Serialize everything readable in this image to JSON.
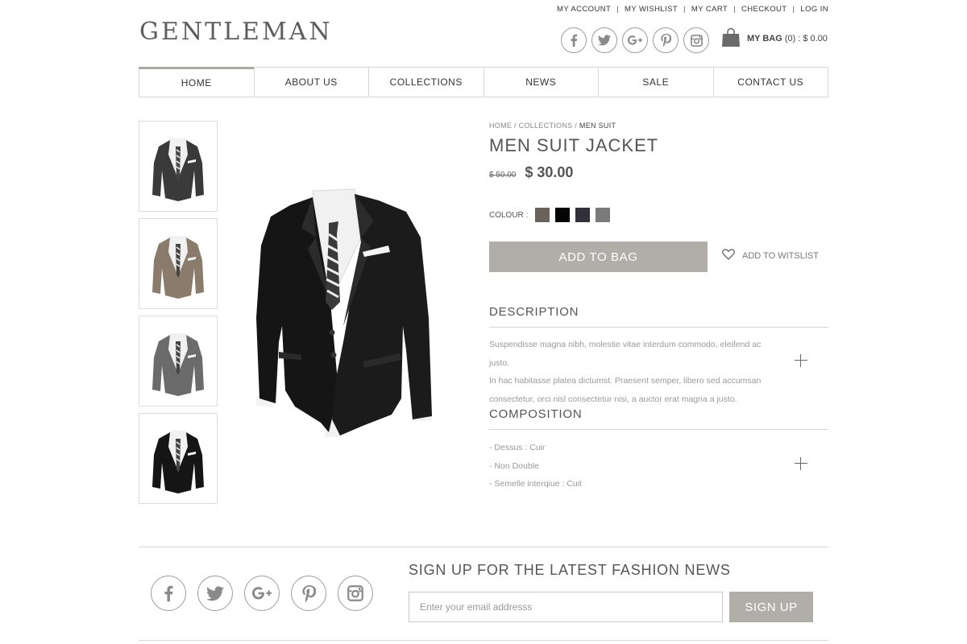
{
  "top_links": [
    "MY ACCOUNT",
    "MY WISHLIST",
    "MY CART",
    "CHECKOUT",
    "LOG IN"
  ],
  "logo": "GENTLEMAN",
  "header_social": [
    "facebook-icon",
    "twitter-icon",
    "google-plus-icon",
    "pinterest-icon",
    "instagram-icon"
  ],
  "bag": {
    "label": "MY BAG",
    "count": "(0)",
    "separator": ":",
    "total": "$ 0.00"
  },
  "nav": [
    {
      "label": "HOME",
      "active": true
    },
    {
      "label": "ABOUT US",
      "active": false
    },
    {
      "label": "COLLECTIONS",
      "active": false
    },
    {
      "label": "NEWS",
      "active": false
    },
    {
      "label": "SALE",
      "active": false
    },
    {
      "label": "CONTACT US",
      "active": false
    }
  ],
  "thumbnails": [
    {
      "color": "#3a3a3a"
    },
    {
      "color": "#8b7b6b"
    },
    {
      "color": "#6b6b6b"
    },
    {
      "color": "#151515"
    }
  ],
  "product": {
    "breadcrumb": {
      "home": "HOME",
      "collections": "COLLECTIONS",
      "current": "MEN SUIT",
      "sep": "/"
    },
    "title": "MEN SUIT JACKET",
    "old_price": "$ 50.00",
    "new_price": "$ 30.00",
    "colour_label": "COLOUR :",
    "colours": [
      "#6b625b",
      "#050505",
      "#30313a",
      "#7b7b7b"
    ],
    "add_to_bag": "ADD TO BAG",
    "wishlist": "ADD TO WITSLIST"
  },
  "description": {
    "title": "DESCRIPTION",
    "lines": [
      "Suspendisse magna nibh, molestie vitae interdum commodo, eleifend ac justo.",
      "In hac habitasse platea dictumst. Praesent semper, libero sed accumsan",
      "consectetur, orci nisl consectetur nisi, a auctor erat magna a justo."
    ]
  },
  "composition": {
    "title": "COMPOSITION",
    "lines": [
      "- Dessus : Cuir",
      "- Non Double",
      "- Semelle interqiue : Cuit"
    ]
  },
  "footer": {
    "social": [
      "facebook-icon",
      "twitter-icon",
      "google-plus-icon",
      "pinterest-icon",
      "instagram-icon"
    ],
    "newsletter_title": "SIGN UP FOR THE LATEST FASHION NEWS",
    "email_placeholder": "Enter your email addresss",
    "signup_label": "SIGN UP"
  }
}
